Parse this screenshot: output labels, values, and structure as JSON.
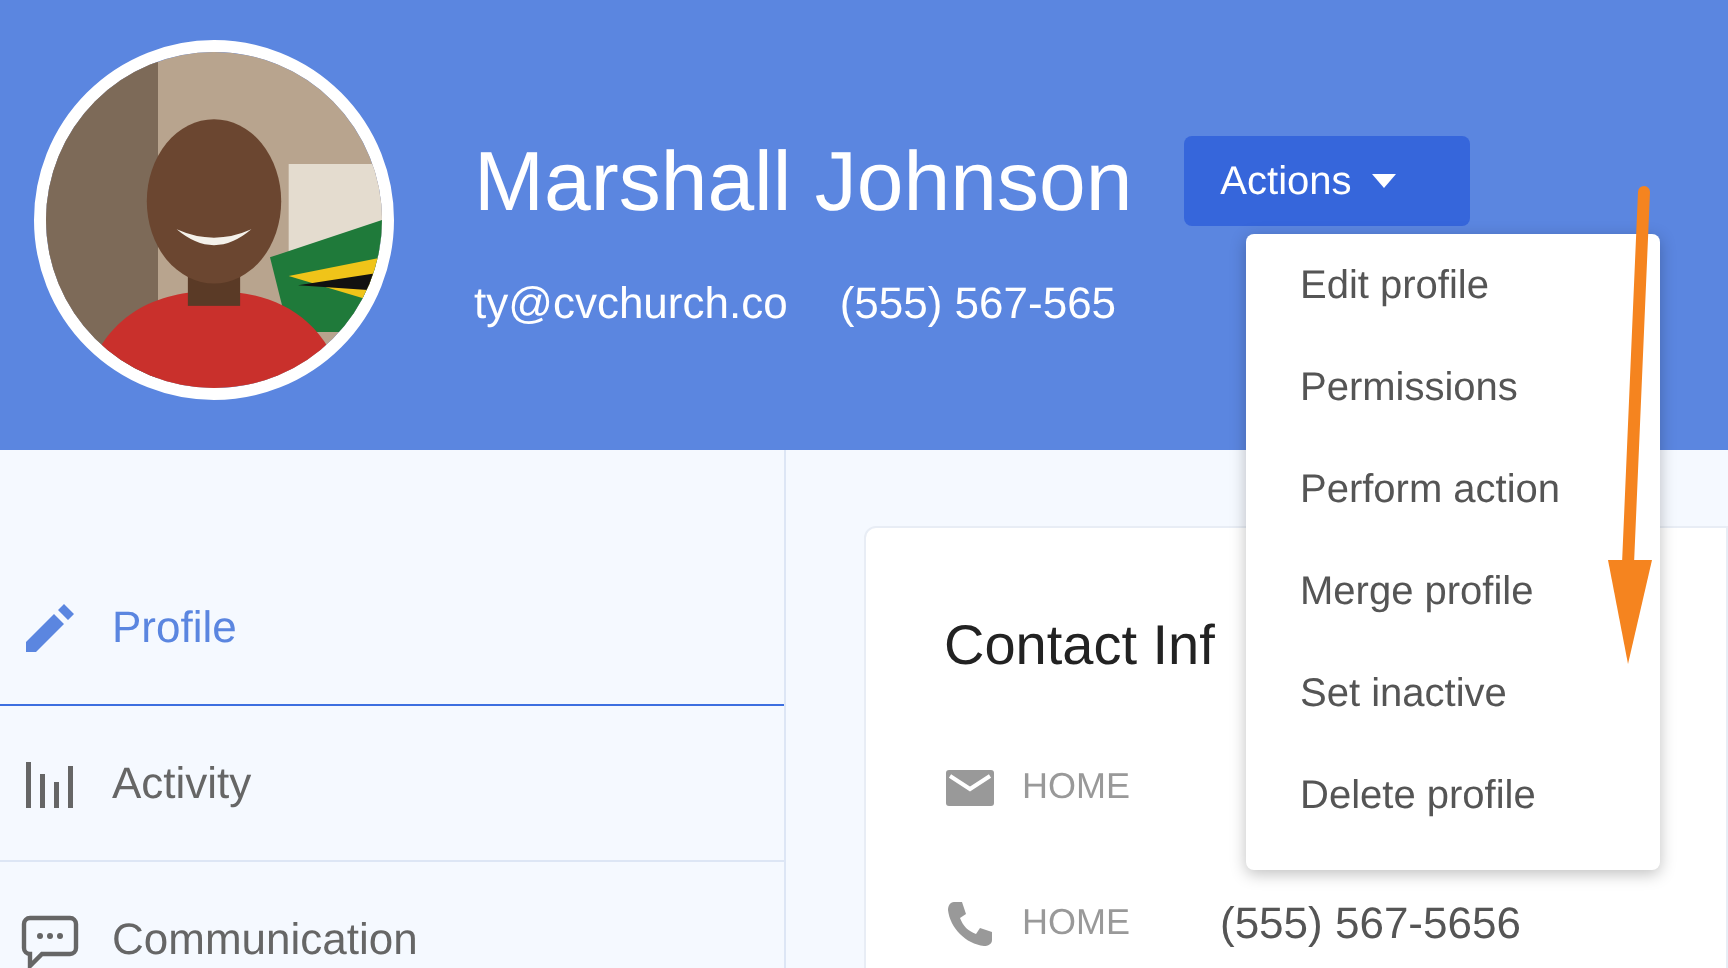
{
  "profile": {
    "name": "Marshall Johnson",
    "email": "ty@cvchurch.co",
    "phone": "(555) 567-565"
  },
  "actions": {
    "label": "Actions",
    "expanded": true,
    "menu": [
      {
        "label": "Edit profile"
      },
      {
        "label": "Permissions"
      },
      {
        "label": "Perform action"
      },
      {
        "label": "Merge profile"
      },
      {
        "label": "Set inactive"
      },
      {
        "label": "Delete profile"
      }
    ]
  },
  "sidebar": {
    "items": [
      {
        "label": "Profile",
        "selected": true
      },
      {
        "label": "Activity",
        "selected": false
      },
      {
        "label": "Communication",
        "selected": false
      }
    ]
  },
  "contact": {
    "title": "Contact Inf",
    "rows": [
      {
        "label": "HOME"
      },
      {
        "label": "HOME",
        "value": "(555) 567-5656"
      }
    ]
  }
}
